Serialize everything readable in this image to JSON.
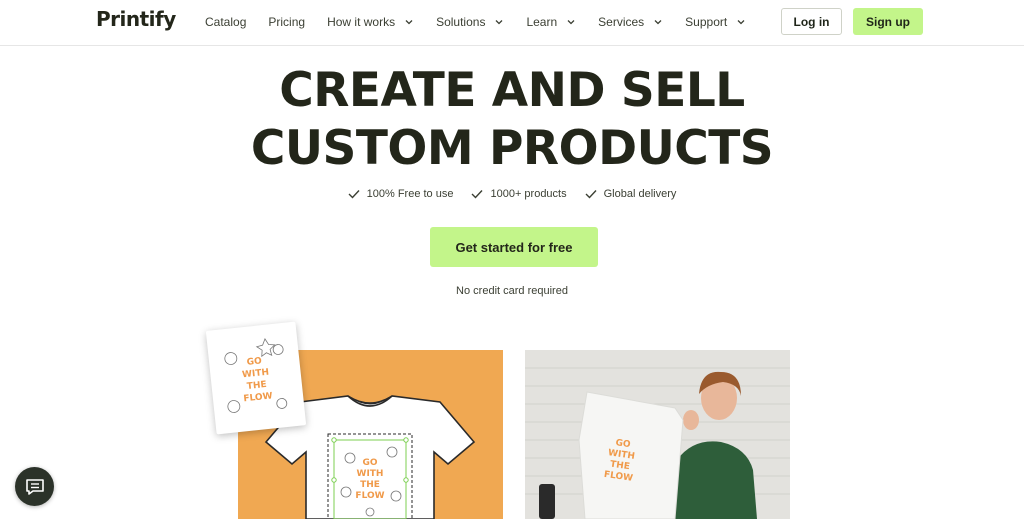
{
  "header": {
    "logo": "Printify",
    "nav": [
      {
        "label": "Catalog",
        "dropdown": false
      },
      {
        "label": "Pricing",
        "dropdown": false
      },
      {
        "label": "How it works",
        "dropdown": true
      },
      {
        "label": "Solutions",
        "dropdown": true
      },
      {
        "label": "Learn",
        "dropdown": true
      },
      {
        "label": "Services",
        "dropdown": true
      },
      {
        "label": "Support",
        "dropdown": true
      }
    ],
    "login_label": "Log in",
    "signup_label": "Sign up"
  },
  "hero": {
    "title_line1": "CREATE AND SELL",
    "title_line2": "CUSTOM PRODUCTS",
    "features": [
      "100% Free to use",
      "1000+ products",
      "Global delivery"
    ],
    "cta_label": "Get started for free",
    "note": "No credit card required"
  },
  "artwork_text": [
    "GO",
    "WITH",
    "THE",
    "FLOW"
  ],
  "icons": [
    "check-icon",
    "chevron-down-icon",
    "chat-icon"
  ],
  "colors": {
    "brand_dark": "#23261a",
    "accent_green": "#c3f58a",
    "orange_panel": "#f0a852",
    "artwork_orange": "#f09a4a"
  }
}
